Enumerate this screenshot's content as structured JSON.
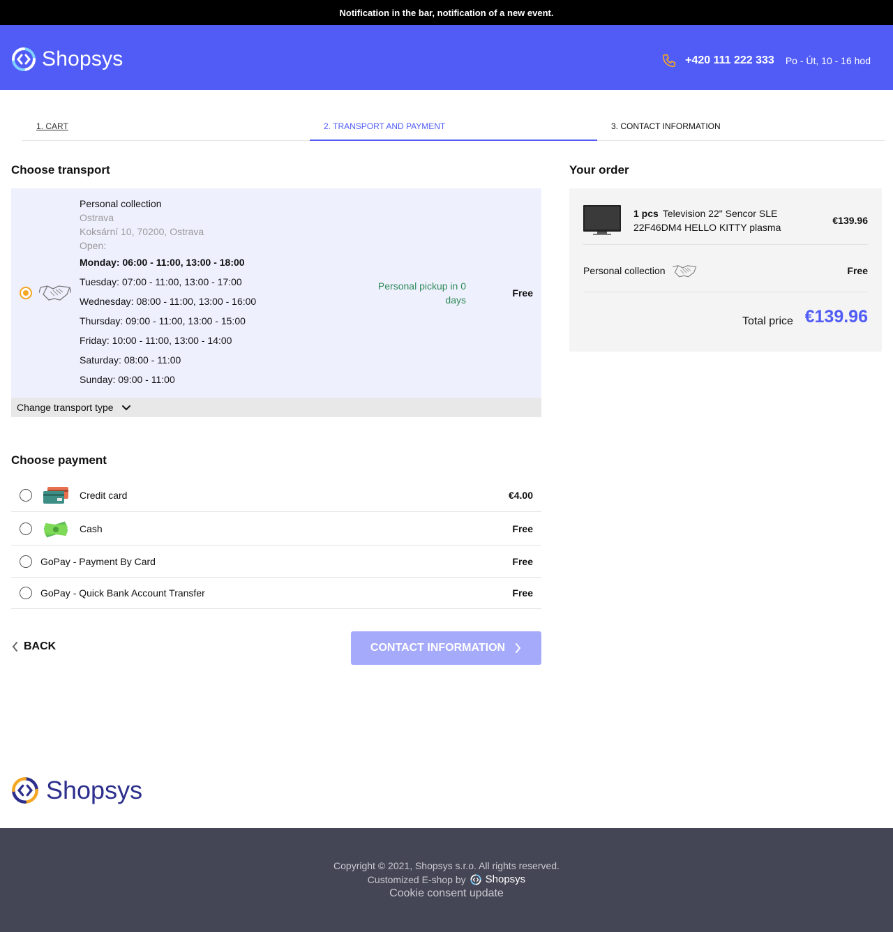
{
  "notification": "Notification in the bar, notification of a new event.",
  "header": {
    "logo_text": "Shopsys",
    "phone": "+420 111 222 333",
    "hours": "Po - Út, 10 - 16 hod"
  },
  "steps": [
    "1. CART",
    "2. TRANSPORT AND PAYMENT",
    "3. CONTACT INFORMATION"
  ],
  "transport": {
    "heading": "Choose transport",
    "name": "Personal collection",
    "city": "Ostrava",
    "address": "Koksární 10, 70200, Ostrava",
    "open_label": "Open:",
    "days": [
      "Monday: 06:00 - 11:00, 13:00 - 18:00",
      "Tuesday: 07:00 - 11:00, 13:00 - 17:00",
      "Wednesday: 08:00 - 11:00, 13:00 - 16:00",
      "Thursday: 09:00 - 11:00, 13:00 - 15:00",
      "Friday: 10:00 - 11:00, 13:00 - 14:00",
      "Saturday: 08:00 - 11:00",
      "Sunday: 09:00 - 11:00"
    ],
    "delivery": "Personal pickup in 0 days",
    "price": "Free",
    "change_label": "Change transport type"
  },
  "payment": {
    "heading": "Choose payment",
    "options": [
      {
        "label": "Credit card",
        "price": "€4.00"
      },
      {
        "label": "Cash",
        "price": "Free"
      },
      {
        "label": "GoPay - Payment By Card",
        "price": "Free"
      },
      {
        "label": "GoPay - Quick Bank Account Transfer",
        "price": "Free"
      }
    ]
  },
  "nav": {
    "back": "BACK",
    "next": "CONTACT INFORMATION"
  },
  "order": {
    "heading": "Your order",
    "item_qty": "1 pcs",
    "item_name": "Television 22\" Sencor SLE 22F46DM4 HELLO KITTY plasma",
    "item_price": "€139.96",
    "transport_name": "Personal collection",
    "transport_price": "Free",
    "total_label": "Total price",
    "total_value": "€139.96"
  },
  "footer": {
    "logo_text": "Shopsys",
    "copyright": "Copyright © 2021, Shopsys s.r.o. All rights reserved.",
    "customized": "Customized E-shop by",
    "customized_brand": "Shopsys",
    "cookie": "Cookie consent update"
  },
  "colors": {
    "brand": "#515cf6",
    "accent": "#f5a623",
    "delivery_green": "#2e8b57",
    "footer_bg": "#454655"
  }
}
